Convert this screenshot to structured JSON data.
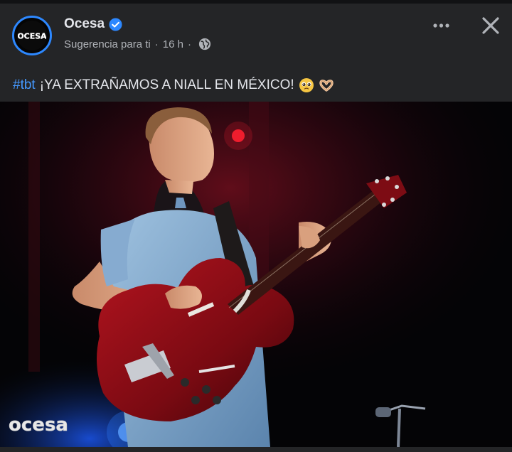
{
  "post": {
    "page_name": "Ocesa",
    "verified": true,
    "meta": {
      "suggestion": "Sugerencia para ti",
      "separator": "·",
      "time": "16 h",
      "audience_icon": "globe-icon"
    },
    "caption": {
      "hashtag": "#tbt",
      "text": "¡YA EXTRAÑAMOS A NIALL EN MÉXICO!",
      "emojis": [
        "pleading-face-emoji",
        "heart-hands-emoji"
      ]
    },
    "avatar_logo": "OCESA",
    "photo": {
      "watermark": "ocesa"
    },
    "actions": {
      "more_icon": "more-horizontal-icon",
      "close_icon": "close-icon"
    }
  },
  "colors": {
    "background": "#242527",
    "accent": "#2d88ff",
    "hashtag": "#4599ff",
    "secondary_text": "#b0b3b8"
  }
}
